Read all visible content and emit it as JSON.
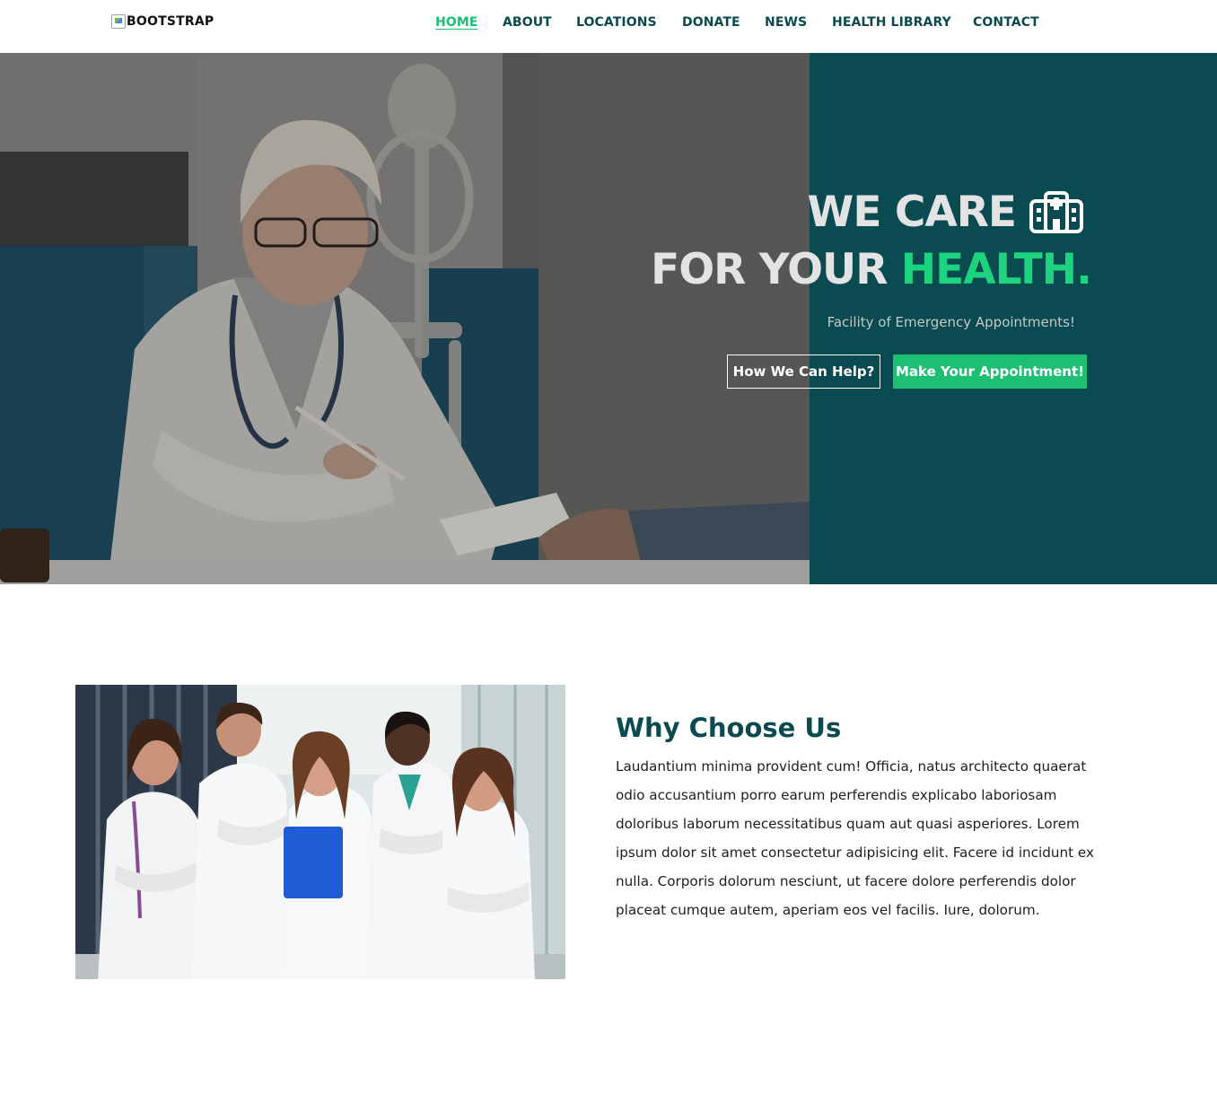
{
  "navbar": {
    "brand_alt_text": "BOOTSTRAP",
    "links": [
      "HOME",
      "ABOUT",
      "LOCATIONS",
      "DONATE",
      "NEWS",
      "HEALTH LIBRARY",
      "CONTACT"
    ],
    "active_index": 0
  },
  "hero": {
    "title_line1": "WE CARE",
    "title_line2_part1": "FOR YOUR ",
    "title_line2_accent": "HEALTH.",
    "icon": "hospital-icon",
    "subtitle": "Facility of Emergency Appointments!",
    "primary_button": "How We Can Help?",
    "secondary_button": "Make Your Appointment!"
  },
  "why_choose": {
    "title": "Why Choose Us",
    "body": "Laudantium minima provident cum! Officia, natus architecto quaerat odio accusantium porro earum perferendis explicabo laboriosam doloribus laborum necessitatibus quam aut quasi asperiores. Lorem ipsum dolor sit amet consectetur adipisicing elit. Facere id incidunt ex nulla. Corporis dolorum nesciunt, ut facere dolore perferendis dolor placeat cumque autem, aperiam eos vel facilis. Iure, dolorum."
  },
  "colors": {
    "brand_dark": "#0a4a51",
    "accent_green": "#1dbf73"
  }
}
